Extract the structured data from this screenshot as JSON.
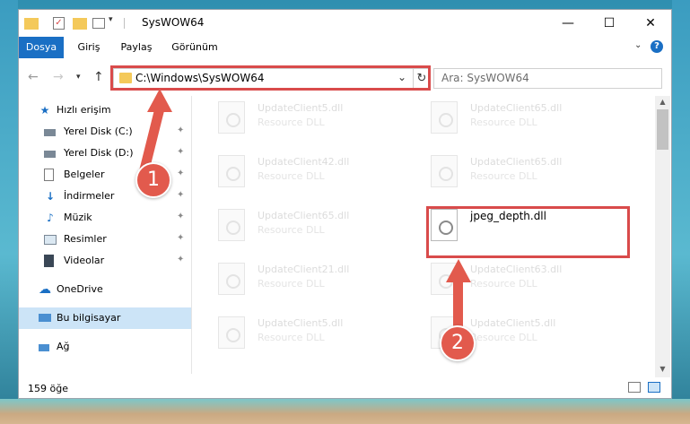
{
  "window": {
    "title": "SysWOW64",
    "minimize_icon": "minimize-icon",
    "maximize_icon": "maximize-icon",
    "close_icon": "close-icon"
  },
  "ribbon": {
    "tabs": [
      {
        "label": "Dosya",
        "active": true
      },
      {
        "label": "Giriş"
      },
      {
        "label": "Paylaş"
      },
      {
        "label": "Görünüm"
      }
    ]
  },
  "address": {
    "path": "C:\\Windows\\SysWOW64",
    "search_placeholder": "Ara: SysWOW64"
  },
  "sidebar": {
    "items": [
      {
        "label": "Hızlı erişim",
        "icon": "star-icon"
      },
      {
        "label": "Yerel Disk (C:)",
        "icon": "drive-icon",
        "pinned": true
      },
      {
        "label": "Yerel Disk (D:)",
        "icon": "drive-icon",
        "pinned": true
      },
      {
        "label": "Belgeler",
        "icon": "document-icon",
        "pinned": true
      },
      {
        "label": "İndirmeler",
        "icon": "download-icon",
        "pinned": true
      },
      {
        "label": "Müzik",
        "icon": "music-icon",
        "pinned": true
      },
      {
        "label": "Resimler",
        "icon": "picture-icon",
        "pinned": true
      },
      {
        "label": "Videolar",
        "icon": "video-icon",
        "pinned": true
      },
      {
        "label": "OneDrive",
        "icon": "cloud-icon"
      },
      {
        "label": "Bu bilgisayar",
        "icon": "computer-icon",
        "selected": true
      },
      {
        "label": "Ağ",
        "icon": "network-icon"
      }
    ]
  },
  "files": {
    "left_column": [
      {
        "name": "UpdateClient5.dll",
        "type": "Resource DLL"
      },
      {
        "name": "UpdateClient42.dll",
        "type": "Resource DLL"
      },
      {
        "name": "UpdateClient65.dll",
        "type": "Resource DLL"
      },
      {
        "name": "UpdateClient21.dll",
        "type": "Resource DLL"
      },
      {
        "name": "UpdateClient5.dll",
        "type": "Resource DLL"
      }
    ],
    "right_column": [
      {
        "name": "UpdateClient65.dll",
        "type": "Resource DLL"
      },
      {
        "name": "UpdateClient65.dll",
        "type": "Resource DLL"
      },
      {
        "name": "jpeg_depth.dll",
        "type": ""
      },
      {
        "name": "UpdateClient63.dll",
        "type": "Resource DLL"
      },
      {
        "name": "UpdateClient5.dll",
        "type": "Resource DLL"
      }
    ]
  },
  "status": {
    "item_count": "159 öğe"
  },
  "annotations": {
    "step1": "1",
    "step2": "2",
    "color": "#e25a4d"
  }
}
